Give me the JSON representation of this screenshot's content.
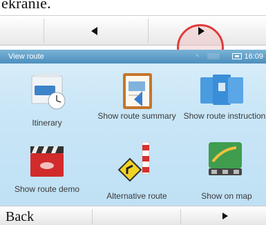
{
  "caption": "ekranie.",
  "screen": {
    "title": "View route",
    "status": {
      "gps": "░░░",
      "time": "16:09"
    },
    "items": [
      {
        "label": "Itinerary"
      },
      {
        "label": "Show route summary"
      },
      {
        "label": "Show route instructions"
      },
      {
        "label": "Show route demo"
      },
      {
        "label": "Alternative route"
      },
      {
        "label": "Show on map"
      }
    ]
  },
  "bottombar": {
    "back_label": "Back"
  },
  "colors": {
    "highlight": "#e23a3a",
    "status_bar": "#4c8fbd",
    "screen_bg": "#c9e6f7"
  }
}
